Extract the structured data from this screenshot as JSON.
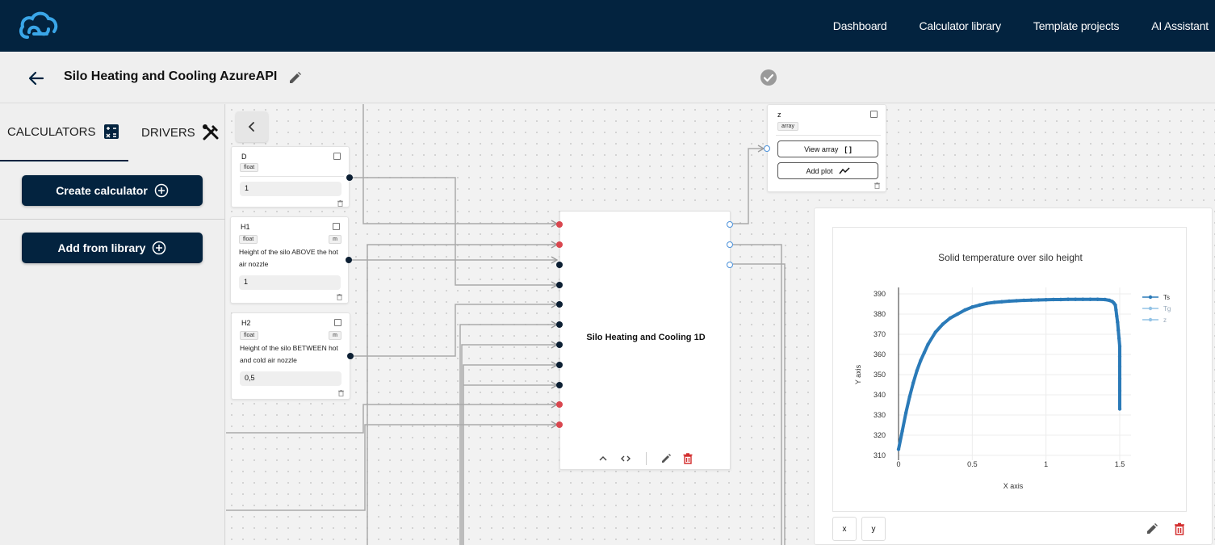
{
  "nav": {
    "items": [
      "Dashboard",
      "Calculator library",
      "Template projects",
      "AI Assistant"
    ]
  },
  "project": {
    "title": "Silo Heating and Cooling AzureAPI"
  },
  "sidebar": {
    "tabs": [
      {
        "label": "CALCULATORS",
        "icon": "calculator-icon",
        "active": true
      },
      {
        "label": "DRIVERS",
        "icon": "tools-icon",
        "active": false
      }
    ],
    "buttons": {
      "create": "Create calculator",
      "library": "Add from library"
    }
  },
  "inputs": [
    {
      "name": "D",
      "type": "float",
      "unit": "",
      "description": "",
      "value": "1"
    },
    {
      "name": "H1",
      "type": "float",
      "unit": "m",
      "description": "Height of the silo ABOVE the hot air nozzle",
      "value": "1"
    },
    {
      "name": "H2",
      "type": "float",
      "unit": "m",
      "description": "Height of the silo BETWEEN hot and cold air nozzle",
      "value": "0,5"
    }
  ],
  "output_node": {
    "name": "z",
    "type": "array",
    "view_label": "View array",
    "view_glyph": "[ ]",
    "plot_label": "Add plot"
  },
  "calculator": {
    "title": "Silo Heating and Cooling 1D"
  },
  "colors": {
    "navy": "#03233f",
    "port_red": "#d9474f",
    "series_ts": "#2a7ab8",
    "series_tg": "#93c3e6",
    "delete_red": "#d32f2f"
  },
  "plot_controls": {
    "x_label": "x",
    "y_label": "y"
  },
  "chart_data": {
    "type": "line",
    "title": "Solid temperature over silo height",
    "xlabel": "X axis",
    "ylabel": "Y axis",
    "xlim": [
      0,
      1.5
    ],
    "ylim": [
      310,
      390
    ],
    "xticks": [
      0,
      0.5,
      1,
      1.5
    ],
    "xtick_labels": [
      "0",
      "0.5",
      "1",
      "1.5"
    ],
    "yticks": [
      310,
      320,
      330,
      340,
      350,
      360,
      370,
      380,
      390
    ],
    "legend_position": "top-right",
    "grid": true,
    "series": [
      {
        "name": "Ts",
        "x": [
          0,
          0.025,
          0.05,
          0.075,
          0.1,
          0.125,
          0.15,
          0.175,
          0.2,
          0.25,
          0.3,
          0.35,
          0.4,
          0.45,
          0.5,
          0.55,
          0.6,
          0.65,
          0.7,
          0.75,
          0.8,
          0.85,
          0.9,
          0.95,
          1.0,
          1.05,
          1.1,
          1.15,
          1.2,
          1.25,
          1.3,
          1.35,
          1.4,
          1.43,
          1.45,
          1.46,
          1.47,
          1.475,
          1.48,
          1.485,
          1.49,
          1.495,
          1.5,
          1.5,
          1.5,
          1.5,
          1.5,
          1.5
        ],
        "y": [
          313,
          322,
          331,
          339,
          346,
          352,
          357,
          361,
          365,
          371,
          375,
          378,
          380,
          382,
          383.5,
          384.5,
          385.3,
          385.8,
          386.1,
          386.4,
          386.6,
          386.8,
          386.9,
          387.0,
          387.1,
          387.2,
          387.2,
          387.3,
          387.3,
          387.3,
          387.3,
          387.3,
          387.2,
          386.8,
          386.2,
          385.5,
          384.5,
          382,
          379,
          376,
          372,
          368,
          364,
          359,
          354,
          348,
          342,
          333
        ]
      },
      {
        "name": "Tg",
        "x": [],
        "y": []
      },
      {
        "name": "z",
        "x": [],
        "y": []
      }
    ]
  }
}
